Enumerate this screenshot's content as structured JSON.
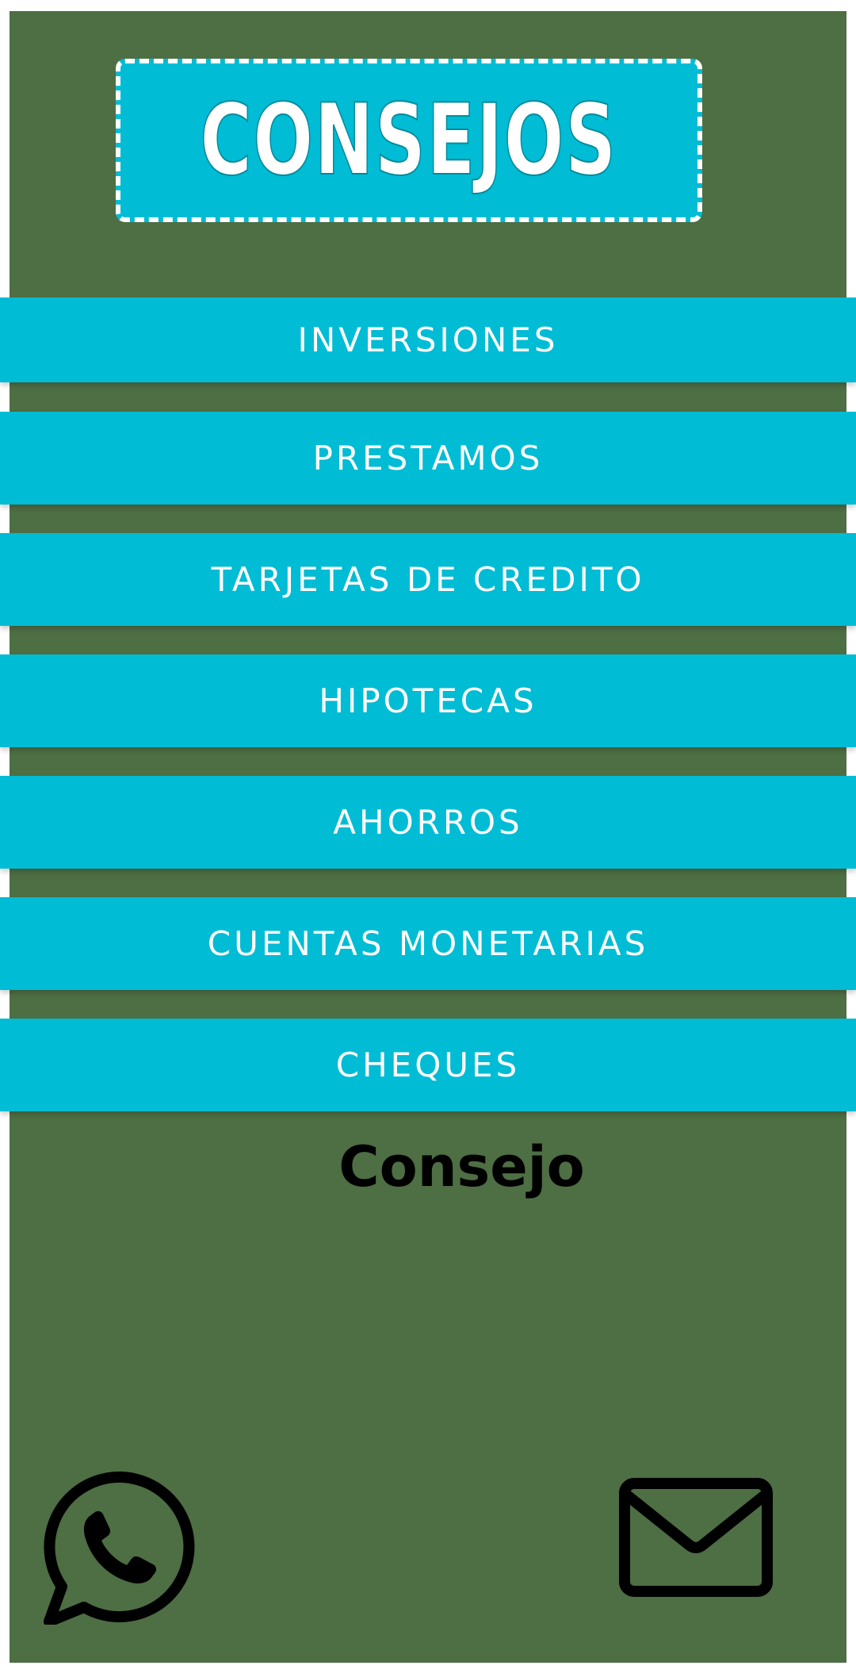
{
  "header": {
    "title": "CONSEJOS"
  },
  "menu": {
    "items": [
      {
        "label": "INVERSIONES"
      },
      {
        "label": "PRESTAMOS"
      },
      {
        "label": "TARJETAS DE CREDITO"
      },
      {
        "label": "HIPOTECAS"
      },
      {
        "label": "AHORROS"
      },
      {
        "label": "CUENTAS MONETARIAS"
      },
      {
        "label": "CHEQUES"
      }
    ]
  },
  "content": {
    "consejo_label": "Consejo"
  },
  "footer": {
    "icons": [
      "whatsapp-icon",
      "mail-icon"
    ]
  },
  "colors": {
    "background": "#4e6e44",
    "accent": "#00bcd4",
    "button_text": "#ffffff"
  }
}
